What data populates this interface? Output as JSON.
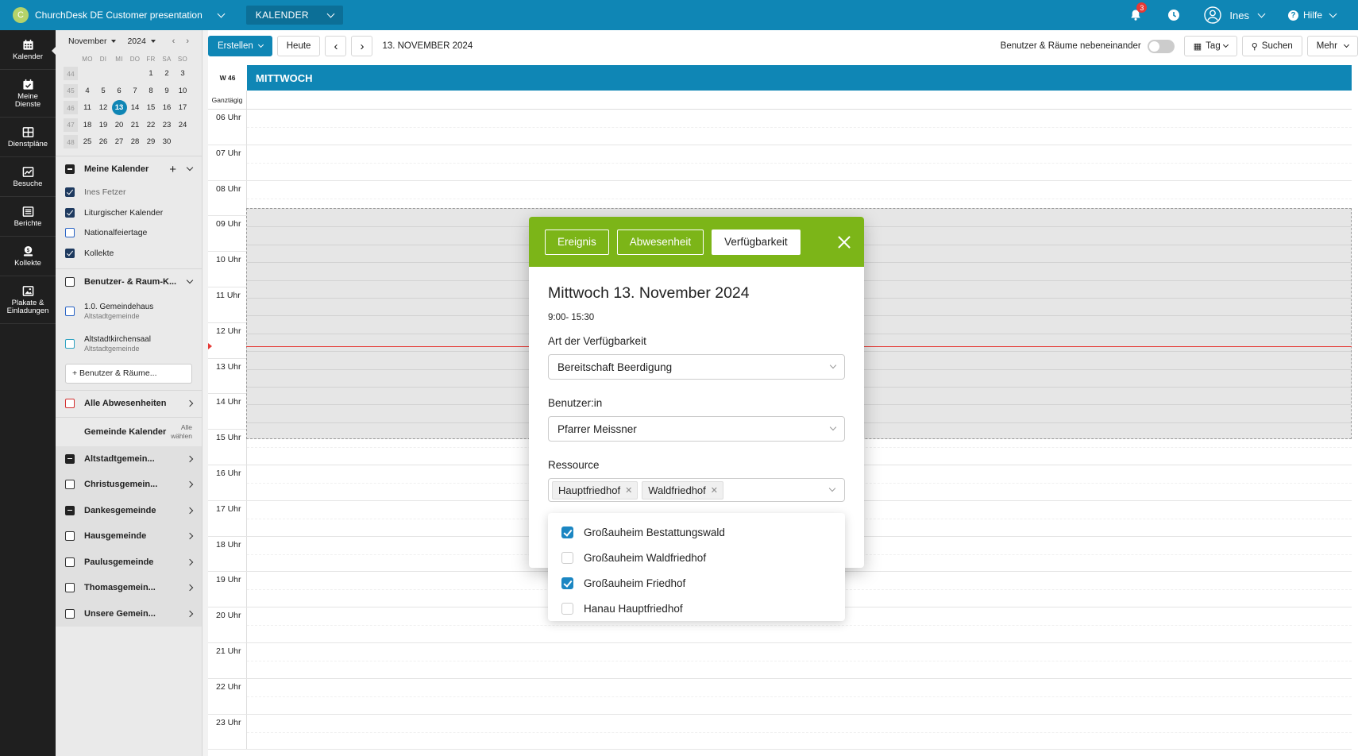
{
  "topbar": {
    "org_initial": "C",
    "org_name": "ChurchDesk DE Customer presentation",
    "module": "KALENDER",
    "notifications_count": "3",
    "user_name": "Ines",
    "help_label": "Hilfe",
    "brand_color": "#0f86b5"
  },
  "leftnav": {
    "items": [
      {
        "label": "Kalender",
        "icon": "calendar-icon"
      },
      {
        "label": "Meine Dienste",
        "icon": "calendar-check-icon"
      },
      {
        "label": "Dienstpläne",
        "icon": "grid-icon"
      },
      {
        "label": "Besuche",
        "icon": "chart-icon"
      },
      {
        "label": "Berichte",
        "icon": "list-icon"
      },
      {
        "label": "Kollekte",
        "icon": "money-icon"
      },
      {
        "label": "Plakate & Einladungen",
        "icon": "image-icon"
      }
    ]
  },
  "minical": {
    "month": "November",
    "year": "2024",
    "weekdays": [
      "MO",
      "DI",
      "MI",
      "DO",
      "FR",
      "SA",
      "SO"
    ],
    "weeks": [
      {
        "no": "44",
        "days": [
          "",
          "",
          "",
          "",
          "1",
          "2",
          "3"
        ]
      },
      {
        "no": "45",
        "days": [
          "4",
          "5",
          "6",
          "7",
          "8",
          "9",
          "10"
        ]
      },
      {
        "no": "46",
        "days": [
          "11",
          "12",
          "13",
          "14",
          "15",
          "16",
          "17"
        ]
      },
      {
        "no": "47",
        "days": [
          "18",
          "19",
          "20",
          "21",
          "22",
          "23",
          "24"
        ]
      },
      {
        "no": "48",
        "days": [
          "25",
          "26",
          "27",
          "28",
          "29",
          "30",
          ""
        ]
      }
    ],
    "today": "13"
  },
  "sidebar": {
    "my_calendars": "Meine Kalender",
    "my_items": [
      {
        "label": "Ines Fetzer",
        "state": "checked"
      },
      {
        "label": "Liturgischer Kalender",
        "state": "checked"
      },
      {
        "label": "Nationalfeiertage",
        "state": "blue"
      },
      {
        "label": "Kollekte",
        "state": "checked"
      }
    ],
    "users_rooms": "Benutzer- & Raum-K...",
    "rooms": [
      {
        "label": "1.0. Gemeindehaus",
        "sub": "Altstadtgemeinde",
        "state": "blue"
      },
      {
        "label": "Altstadtkirchensaal",
        "sub": "Altstadtgemeinde",
        "state": "teal"
      }
    ],
    "add_button": "+ Benutzer & Räume...",
    "absences": "Alle Abwesenheiten",
    "parish_calendars": "Gemeinde Kalender",
    "select_all": "Alle wählen",
    "parishes": [
      {
        "label": "Altstadtgemein...",
        "state": "dash"
      },
      {
        "label": "Christusgemein...",
        "state": "empty"
      },
      {
        "label": "Dankesgemeinde",
        "state": "dash"
      },
      {
        "label": "Hausgemeinde",
        "state": "empty"
      },
      {
        "label": "Paulusgemeinde",
        "state": "empty"
      },
      {
        "label": "Thomasgemein...",
        "state": "empty"
      },
      {
        "label": "Unsere Gemein...",
        "state": "empty"
      }
    ]
  },
  "toolbar": {
    "create": "Erstellen",
    "today": "Heute",
    "prev": "‹",
    "next": "›",
    "date": "13. NOVEMBER 2024",
    "toggle_label": "Benutzer & Räume nebeneinander",
    "view": "Tag",
    "search": "Suchen",
    "more": "Mehr"
  },
  "calendar": {
    "week": "W 46",
    "day_name": "MITTWOCH",
    "allday": "Ganztägig",
    "hours": [
      "06 Uhr",
      "07 Uhr",
      "08 Uhr",
      "09 Uhr",
      "10 Uhr",
      "11 Uhr",
      "12 Uhr",
      "13 Uhr",
      "14 Uhr",
      "15 Uhr",
      "16 Uhr",
      "17 Uhr",
      "18 Uhr",
      "19 Uhr",
      "20 Uhr",
      "21 Uhr",
      "22 Uhr",
      "23 Uhr"
    ]
  },
  "modal": {
    "tabs": [
      "Ereignis",
      "Abwesenheit",
      "Verfügbarkeit"
    ],
    "active_tab": "Verfügbarkeit",
    "accent": "#7cb518",
    "title": "Mittwoch 13. November 2024",
    "time": "9:00- 15:30",
    "type_label": "Art der Verfügbarkeit",
    "type_value": "Bereitschaft Beerdigung",
    "user_label": "Benutzer:in",
    "user_value": "Pfarrer Meissner",
    "resource_label": "Ressource",
    "resource_tags": [
      "Hauptfriedhof",
      "Waldfriedhof"
    ],
    "options": [
      {
        "label": "Großauheim Bestattungswald",
        "checked": true
      },
      {
        "label": "Großauheim Waldfriedhof",
        "checked": false
      },
      {
        "label": "Großauheim Friedhof",
        "checked": true
      },
      {
        "label": "Hanau Hauptfriedhof",
        "checked": false
      }
    ]
  }
}
